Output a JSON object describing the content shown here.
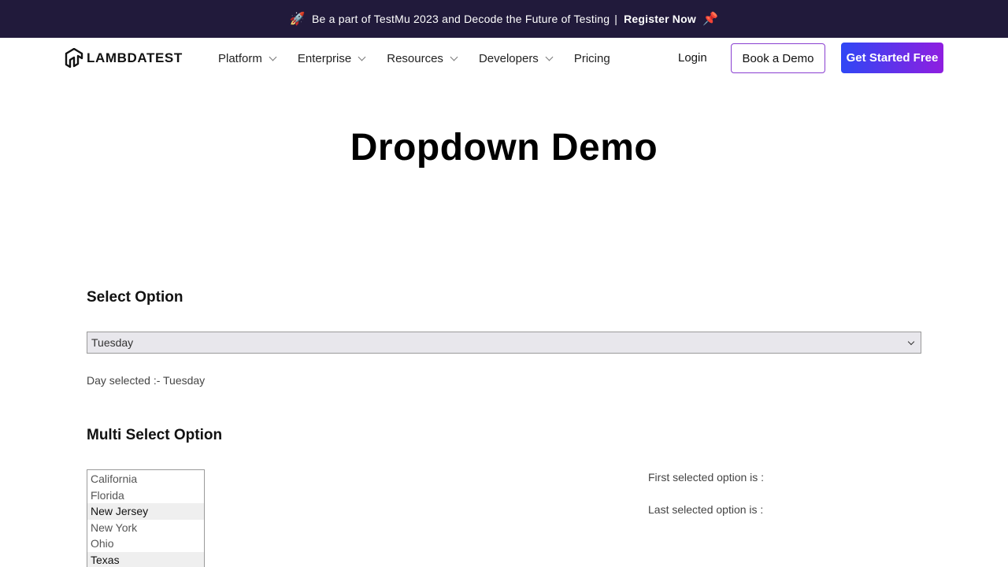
{
  "announcement": {
    "icon_left": "rocket-icon",
    "text": "Be a part of TestMu 2023 and Decode the Future of Testing",
    "separator": "|",
    "link_label": "Register Now",
    "icon_right": "pushpin-icon"
  },
  "nav": {
    "logo_text": "LAMBDATEST",
    "menu": [
      {
        "label": "Platform",
        "has_dropdown": true
      },
      {
        "label": "Enterprise",
        "has_dropdown": true
      },
      {
        "label": "Resources",
        "has_dropdown": true
      },
      {
        "label": "Developers",
        "has_dropdown": true
      },
      {
        "label": "Pricing",
        "has_dropdown": false
      }
    ],
    "login_label": "Login",
    "book_demo_label": "Book a Demo",
    "get_started_label": "Get Started Free"
  },
  "page": {
    "title": "Dropdown Demo"
  },
  "select_section": {
    "title": "Select Option",
    "selected_value": "Tuesday",
    "result_text": "Day selected :- Tuesday"
  },
  "multi_section": {
    "title": "Multi Select Option",
    "options": [
      {
        "label": "California",
        "highlighted": false
      },
      {
        "label": "Florida",
        "highlighted": false
      },
      {
        "label": "New Jersey",
        "highlighted": true
      },
      {
        "label": "New York",
        "highlighted": false
      },
      {
        "label": "Ohio",
        "highlighted": false
      },
      {
        "label": "Texas",
        "highlighted": true
      }
    ],
    "first_selected_label": "First selected option is :",
    "last_selected_label": "Last selected option is :"
  },
  "colors": {
    "announcement_bg": "#211a3b",
    "cta_gradient_start": "#2f47f5",
    "cta_gradient_end": "#8f1ee0"
  }
}
